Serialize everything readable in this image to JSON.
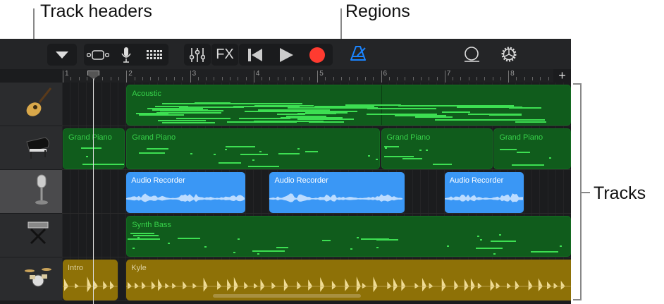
{
  "callouts": {
    "track_headers": "Track headers",
    "regions": "Regions",
    "tracks": "Tracks"
  },
  "toolbar": {
    "fx_label": "FX",
    "metronome_color": "#1a84ff",
    "record_color": "#ff3b30"
  },
  "ruler": {
    "bars": [
      "1",
      "2",
      "3",
      "4",
      "5",
      "6",
      "7",
      "8"
    ],
    "add_label": "+"
  },
  "tracks": [
    {
      "name": "acoustic-guitar",
      "icon": "guitar-icon",
      "regions": [
        {
          "label": "Acoustic",
          "start": 2,
          "end": 9,
          "color": "green",
          "split": 6
        }
      ]
    },
    {
      "name": "grand-piano",
      "icon": "piano-icon",
      "regions": [
        {
          "label": "Grand Piano",
          "start": 1,
          "end": 1.98,
          "color": "green"
        },
        {
          "label": "Grand Piano",
          "start": 2,
          "end": 5.98,
          "color": "green"
        },
        {
          "label": "Grand Piano",
          "start": 6,
          "end": 7.75,
          "color": "green"
        },
        {
          "label": "Grand Piano",
          "start": 7.77,
          "end": 9,
          "color": "green"
        }
      ]
    },
    {
      "name": "audio-recorder",
      "icon": "microphone-icon",
      "selected": true,
      "regions": [
        {
          "label": "Audio Recorder",
          "start": 2,
          "end": 3.87,
          "color": "blue"
        },
        {
          "label": "Audio Recorder",
          "start": 4.25,
          "end": 6.37,
          "color": "blue"
        },
        {
          "label": "Audio Recorder",
          "start": 7,
          "end": 8.24,
          "color": "blue"
        }
      ]
    },
    {
      "name": "synth-bass",
      "icon": "keyboard-icon",
      "regions": [
        {
          "label": "Synth Bass",
          "start": 2,
          "end": 9,
          "color": "green"
        }
      ]
    },
    {
      "name": "drums",
      "icon": "drum-kit-icon",
      "regions": [
        {
          "label": "Intro",
          "start": 1,
          "end": 1.86,
          "color": "gold"
        },
        {
          "label": "Kyle",
          "start": 2,
          "end": 9,
          "color": "gold"
        }
      ]
    }
  ]
}
